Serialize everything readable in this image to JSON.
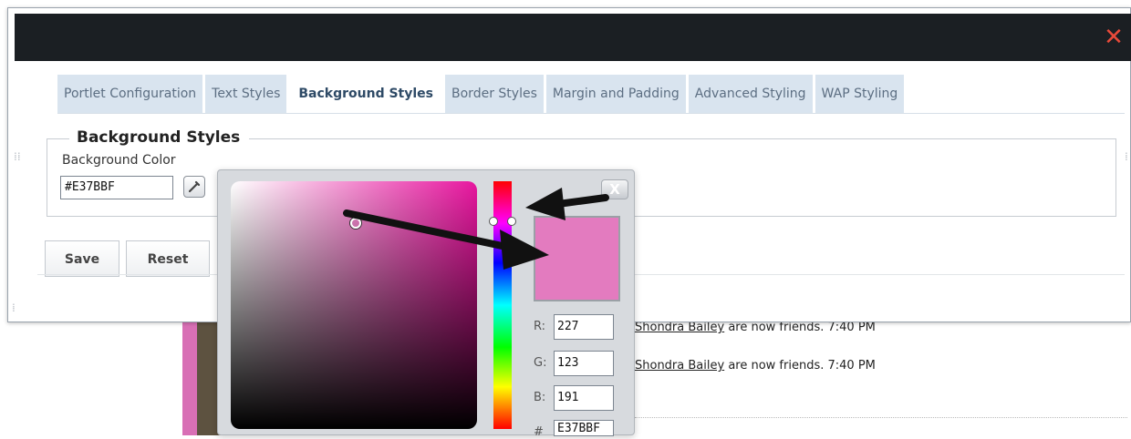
{
  "dialog": {
    "close_symbol": "✕",
    "tabs": [
      {
        "label": "Portlet Configuration",
        "active": false
      },
      {
        "label": "Text Styles",
        "active": false
      },
      {
        "label": "Background Styles",
        "active": true
      },
      {
        "label": "Border Styles",
        "active": false
      },
      {
        "label": "Margin and Padding",
        "active": false
      },
      {
        "label": "Advanced Styling",
        "active": false
      },
      {
        "label": "WAP Styling",
        "active": false
      }
    ],
    "section": {
      "legend": "Background Styles",
      "field_label": "Background Color",
      "color_value": "#E37BBF"
    },
    "buttons": {
      "save": "Save",
      "reset": "Reset"
    }
  },
  "picker": {
    "close_symbol": "X",
    "r_label": "R:",
    "g_label": "G:",
    "b_label": "B:",
    "hex_label": "#",
    "r": "227",
    "g": "123",
    "b": "191",
    "hex": "E37BBF",
    "preview_color": "#E37BBF"
  },
  "feed": {
    "rows": [
      {
        "name": "Shondra Bailey",
        "text": " are now friends. 7:40 PM"
      },
      {
        "name": "Shondra Bailey",
        "text": " are now friends. 7:40 PM"
      }
    ]
  },
  "colors": {
    "titlebar": "#1b1f23",
    "close": "#e84a3a",
    "tab_bg": "#d9e4ef",
    "arrow": "#111111"
  }
}
